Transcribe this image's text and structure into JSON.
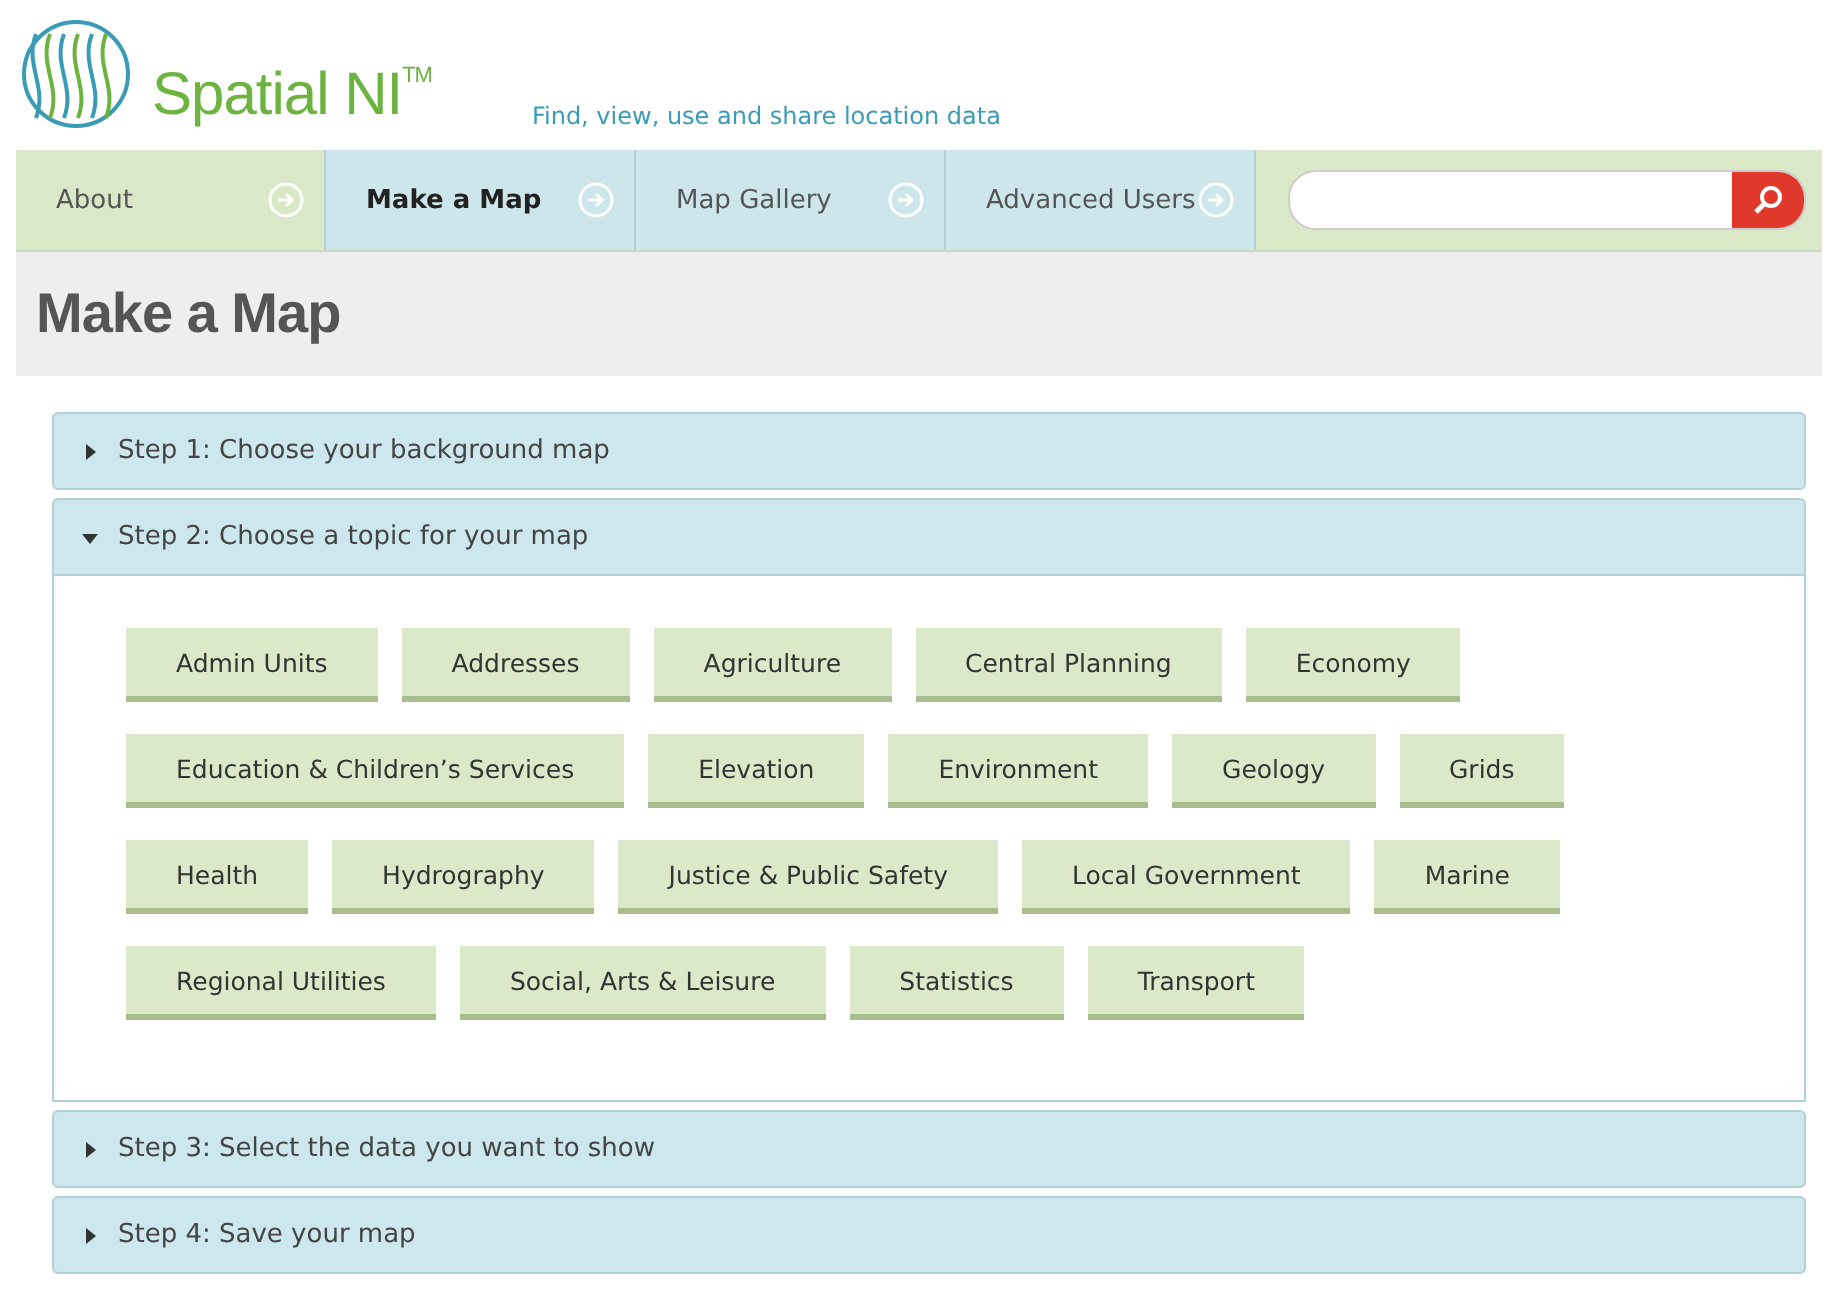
{
  "logo": {
    "name": "Spatial NI$^{TM}$",
    "tagline": "Find, view, use and share location data"
  },
  "nav": [
    {
      "label": "About",
      "selected": false,
      "color": "#d9e8c6"
    },
    {
      "label": "Make a Map",
      "selected": true,
      "color": "#cde6ec"
    },
    {
      "label": "Map Gallery",
      "selected": false,
      "color": "#cde6ec"
    },
    {
      "label": "Advanced Users",
      "selected": false,
      "color": "#cde6ec"
    }
  ],
  "page_title": "Make a Map",
  "steps": [
    {
      "label": "Step 1: Choose your background map",
      "expanded": false
    },
    {
      "label": "Step 2: Choose a topic for your map",
      "expanded": true,
      "topics": [
        "Admin Units",
        "Addresses",
        "Agriculture",
        "Central Planning",
        "Economy",
        "Education & Children’s Services",
        "Elevation",
        "Environment",
        "Geology",
        "Grids",
        "Health",
        "Hydrography",
        "Justice & Public Safety",
        "Local Government",
        "Marine",
        "Regional Utilities",
        "Social, Arts & Leisure",
        "Statistics",
        "Transport"
      ]
    },
    {
      "label": "Step 3: Select the data you want to show",
      "expanded": false
    },
    {
      "label": "Step 4: Save your map",
      "expanded": false
    }
  ]
}
